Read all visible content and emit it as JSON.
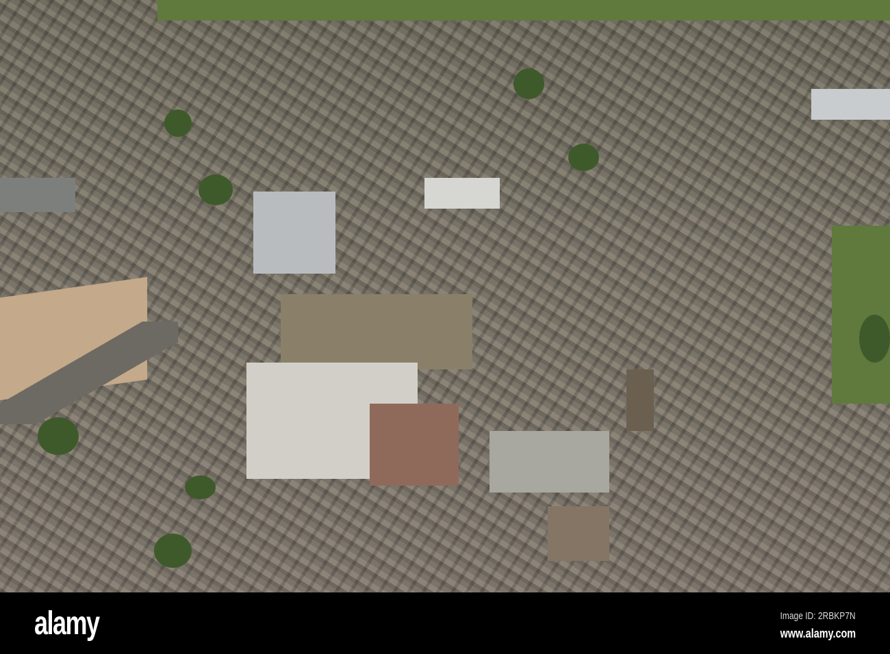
{
  "image": {
    "subject": "aerial-town-centre"
  },
  "watermark": {
    "logo": "alamy",
    "image_id": "Image ID: 2RBKP7N",
    "url": "www.alamy.com"
  },
  "colors": {
    "park_green": "#5f7a3c",
    "tree_green": "#3f5a2a",
    "footer_bg": "#000000"
  }
}
